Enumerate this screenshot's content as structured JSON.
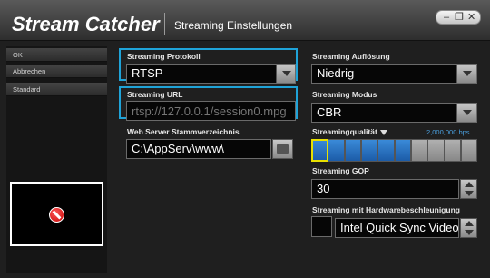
{
  "window": {
    "app_title": "Stream Catcher",
    "dialog_title": "Streaming Einstellungen",
    "controls": [
      "–",
      "❐",
      "✕"
    ]
  },
  "sidebar": {
    "buttons": [
      "OK",
      "Abbrechen",
      "Standard"
    ]
  },
  "left": {
    "protocol_label": "Streaming Protokoll",
    "protocol_value": "RTSP",
    "url_label": "Streaming URL",
    "url_placeholder": "rtsp://127.0.0.1/session0.mpg",
    "webroot_label": "Web Server Stammverzeichnis",
    "webroot_value": "C:\\AppServ\\www\\"
  },
  "right": {
    "resolution_label": "Streaming Auflösung",
    "resolution_value": "Niedrig",
    "mode_label": "Streaming Modus",
    "mode_value": "CBR",
    "quality_label": "Streamingqualität",
    "quality_bps": "2,000,000 bps",
    "quality_level": 6,
    "quality_segments": 10,
    "gop_label": "Streaming GOP",
    "gop_value": "30",
    "hw_label": "Streaming mit Hardwarebeschleunigung",
    "hw_value": "Intel Quick Sync Video",
    "hw_enabled": false
  },
  "colors": {
    "highlight": "#1fa3d8",
    "quality_on": "#2a74c4",
    "quality_selected": "#e8e000"
  }
}
